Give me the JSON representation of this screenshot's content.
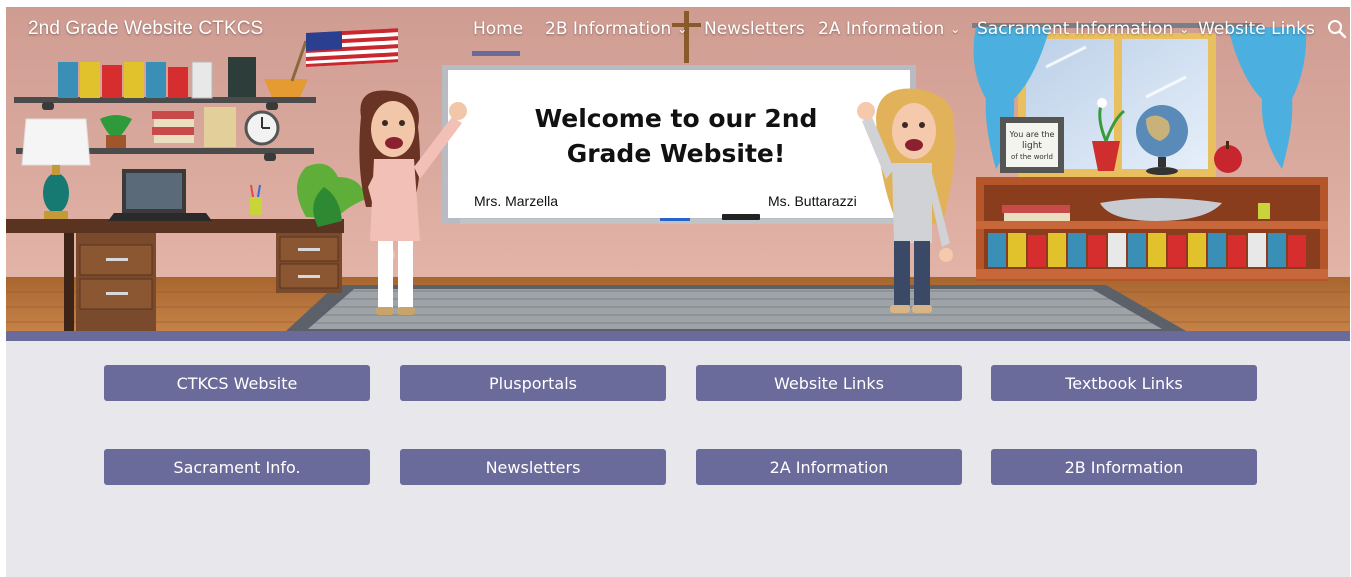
{
  "site": {
    "title": "2nd Grade Website CTKCS"
  },
  "nav": {
    "items": [
      {
        "label": "Home",
        "active": true,
        "has_dropdown": false
      },
      {
        "label": "2B Information",
        "active": false,
        "has_dropdown": true
      },
      {
        "label": "Newsletters",
        "active": false,
        "has_dropdown": false
      },
      {
        "label": "2A Information",
        "active": false,
        "has_dropdown": true
      },
      {
        "label": "Sacrament Information",
        "active": false,
        "has_dropdown": true
      },
      {
        "label": "Website Links",
        "active": false,
        "has_dropdown": false
      }
    ],
    "dropdown_glyph": "⌄",
    "search_icon": "search-icon"
  },
  "hero": {
    "board_heading_line1": "Welcome to our 2nd",
    "board_heading_line2": "Grade Website!",
    "teacher_left": "Mrs. Marzella",
    "teacher_right": "Ms. Buttarazzi",
    "sign_text_line1": "You are the",
    "sign_text_line2": "light",
    "sign_text_line3": "of the world"
  },
  "buttons": {
    "row1": [
      "CTKCS Website",
      "Plusportals",
      "Website Links",
      "Textbook Links"
    ],
    "row2": [
      "Sacrament Info.",
      "Newsletters",
      "2A Information",
      "2B Information"
    ]
  },
  "colors": {
    "accent": "#6b6b9b",
    "page_bg": "#e8e8ec",
    "wall": "#dba89c",
    "floor": "#c07a45"
  }
}
